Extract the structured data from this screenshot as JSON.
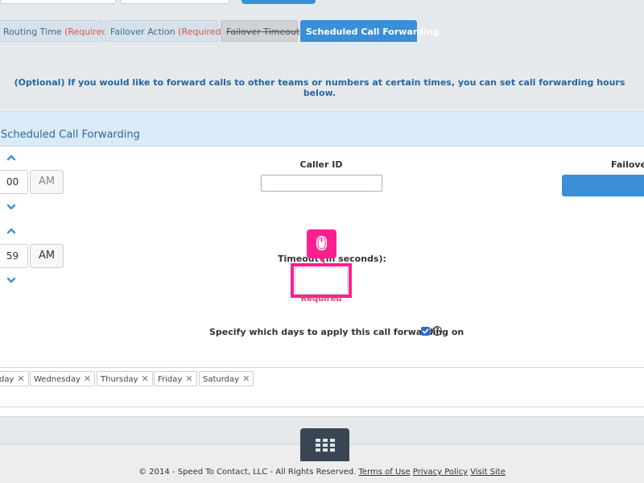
{
  "tabs": {
    "routing_time": "Routing Time",
    "routing_time_req": "(Required)",
    "failover_action": "Failover Action",
    "failover_action_req": "(Required)",
    "failover_timeout": "Failover Timeout",
    "scheduled_call_forwarding": "Scheduled Call Forwarding"
  },
  "info": {
    "text": "(Optional) If you would like to forward calls to other teams or numbers at certain times, you can set call forwarding hours below."
  },
  "panel": {
    "title": "Scheduled Call Forwarding"
  },
  "start_time": {
    "minutes": "00",
    "ampm": "AM"
  },
  "end_time": {
    "minutes": "59",
    "ampm": "AM"
  },
  "caller_id": {
    "label": "Caller ID",
    "value": ""
  },
  "failover": {
    "label": "Failover"
  },
  "timeout": {
    "label": "Timeout (in seconds):",
    "value": "",
    "required": "Required"
  },
  "days": {
    "label": "Specify which days to apply this call forwarding on",
    "checked": true,
    "help": "?",
    "selected": [
      "day",
      "Wednesday",
      "Thursday",
      "Friday",
      "Saturday"
    ],
    "remove_glyph": "✕"
  },
  "footer": {
    "copyright": "© 2014 - Speed To Contact, LLC - All Rights Reserved.",
    "terms": "Terms of Use",
    "privacy": "Privacy Policy",
    "visit": "Visit Site"
  },
  "colors": {
    "accent": "#3b8fd6",
    "highlight": "#ff1f8e",
    "required": "#d9534f",
    "dark": "#3a4653"
  },
  "icons": [
    "chevron-up-icon",
    "chevron-down-icon",
    "mouse-icon",
    "checkbox-icon",
    "help-icon",
    "close-icon",
    "grid-icon"
  ]
}
